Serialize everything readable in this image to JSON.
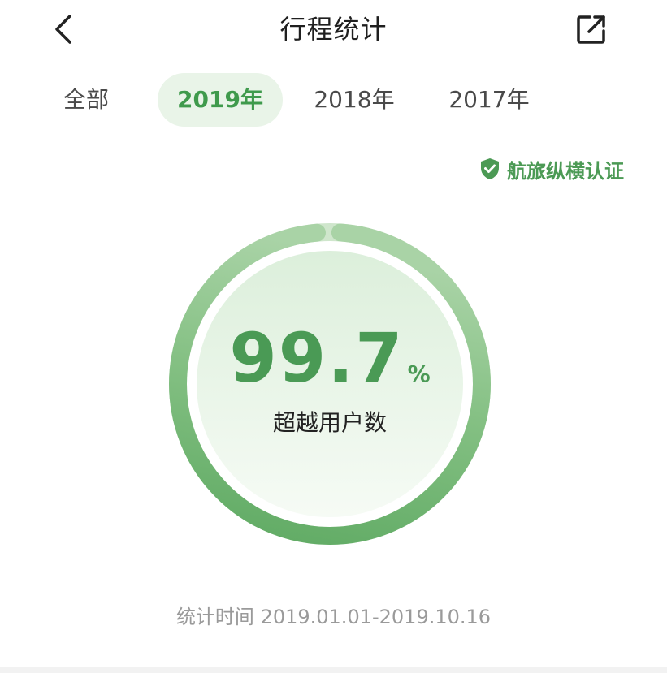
{
  "header": {
    "title": "行程统计",
    "back_icon": "chevron-left-icon",
    "share_icon": "share-external-icon"
  },
  "tabs": [
    {
      "label": "全部",
      "active": false
    },
    {
      "label": "2019年",
      "active": true
    },
    {
      "label": "2018年",
      "active": false
    },
    {
      "label": "2017年",
      "active": false
    }
  ],
  "certification": {
    "label": "航旅纵横认证",
    "icon": "shield-check-icon"
  },
  "gauge": {
    "value": "99.7",
    "unit": "%",
    "label": "超越用户数",
    "fraction": 0.997
  },
  "period": "统计时间 2019.01.01-2019.10.16",
  "colors": {
    "accent": "#4a9a55",
    "tab_active_bg": "#e9f4e8",
    "ring_dark": "#66af6b",
    "ring_light": "#b9dbb5"
  }
}
